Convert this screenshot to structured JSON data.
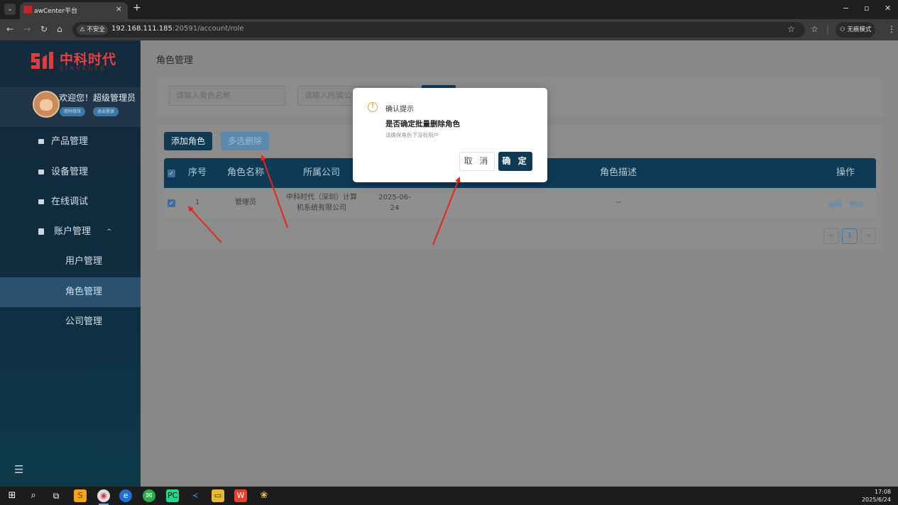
{
  "browser": {
    "tab_title": "awCenter平台",
    "tab_close": "×",
    "new_tab": "+",
    "insecure_label": "⚠ 不安全",
    "url_host": "192.168.111.185",
    "url_rest": ":20591/account/role",
    "incognito_label": "无痕模式",
    "window_min": "−",
    "window_restore": "▫",
    "window_close": "✕"
  },
  "sidebar": {
    "logo_cn": "中科时代",
    "logo_en": "SINSEGYE",
    "welcome": "欢迎您！超级管理员",
    "user_buttons": [
      "密码修改",
      "退出登录"
    ],
    "items": [
      {
        "label": "产品管理"
      },
      {
        "label": "设备管理"
      },
      {
        "label": "在线调试"
      },
      {
        "label": "账户管理",
        "caret": "^"
      },
      {
        "label": "用户管理"
      },
      {
        "label": "角色管理"
      },
      {
        "label": "公司管理"
      }
    ]
  },
  "page": {
    "title": "角色管理",
    "search": {
      "role_name_placeholder": "请输入角色名称",
      "company_placeholder": "请输入所属公司"
    },
    "buttons": {
      "add": "添加角色",
      "batch_delete": "多选删除"
    },
    "table": {
      "columns": [
        "序号",
        "角色名称",
        "所属公司",
        "角色描述",
        "操作"
      ],
      "rows": [
        {
          "index": "1",
          "role_name": "管理员",
          "company_line1": "中科时代（深圳）计算",
          "company_line2": "机系统有限公司",
          "date_line1": "2025-06-",
          "date_line2": "24",
          "description": "--",
          "edit": "编辑",
          "delete": "删除"
        }
      ]
    },
    "pagination": {
      "prev": "<",
      "current": "1",
      "next": ">"
    }
  },
  "dialog": {
    "title": "确认提示",
    "message": "是否确定批量删除角色",
    "sub_message": "请确保角色下没有用户",
    "cancel": "取 消",
    "confirm": "确 定"
  },
  "taskbar": {
    "time": "17:08",
    "date": "2025/6/24"
  },
  "colors": {
    "primary": "#0e3a55",
    "warning": "#e6a23c",
    "annotation_arrow": "#e8231a"
  }
}
